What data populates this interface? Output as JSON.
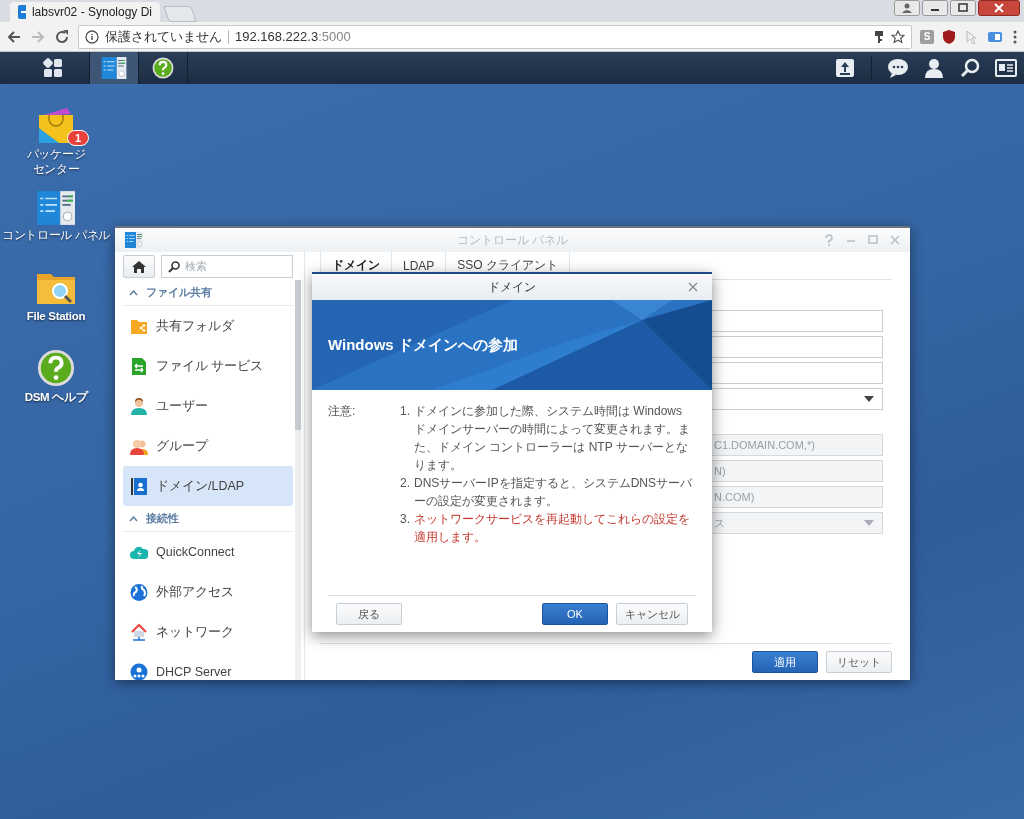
{
  "browser": {
    "tab_title": "labsvr02 - Synology Di",
    "security_label": "保護されていません",
    "url_host": "192.168.222.3",
    "url_port": ":5000",
    "extension_label": "S"
  },
  "taskbar": {
    "apps": [
      {
        "kind": "control-panel",
        "selected": true
      },
      {
        "kind": "help",
        "selected": false
      }
    ]
  },
  "desktop_icons": [
    {
      "kind": "package",
      "label_lines": [
        "パッケージ",
        "センター"
      ],
      "badge": "1"
    },
    {
      "kind": "control-panel",
      "label": "コントロール パネル"
    },
    {
      "kind": "file-station",
      "label": "File Station"
    },
    {
      "kind": "help",
      "label": "DSM ヘルプ"
    }
  ],
  "control_panel": {
    "title": "コントロール パネル",
    "search": {
      "placeholder": "検索"
    },
    "sidebar": [
      {
        "kind": "section",
        "label": "ファイル共有",
        "expanded": true
      },
      {
        "kind": "folder",
        "label": "共有フォルダ",
        "selected": false
      },
      {
        "kind": "file-service",
        "label": "ファイル サービス",
        "selected": false
      },
      {
        "kind": "user",
        "label": "ユーザー",
        "selected": false
      },
      {
        "kind": "group",
        "label": "グループ",
        "selected": false
      },
      {
        "kind": "domain",
        "label": "ドメイン/LDAP",
        "selected": true
      },
      {
        "kind": "section",
        "label": "接続性",
        "expanded": true
      },
      {
        "kind": "cloud",
        "label": "QuickConnect",
        "selected": false
      },
      {
        "kind": "globe",
        "label": "外部アクセス",
        "selected": false
      },
      {
        "kind": "network",
        "label": "ネットワーク",
        "selected": false
      },
      {
        "kind": "dhcp",
        "label": "DHCP Server",
        "selected": false
      }
    ],
    "tabs": [
      {
        "label": "ドメイン",
        "selected": true
      },
      {
        "label": "LDAP",
        "selected": false
      },
      {
        "label": "SSO クライアント",
        "selected": false
      }
    ],
    "field_groups": [
      [
        {
          "kind": "text",
          "disabled": false
        },
        {
          "kind": "text",
          "disabled": false
        },
        {
          "kind": "text",
          "disabled": false
        },
        {
          "kind": "select",
          "disabled": false
        }
      ],
      [
        {
          "kind": "text",
          "disabled": true,
          "placeholder": "C1.DOMAIN.COM,*)"
        },
        {
          "kind": "text",
          "disabled": true,
          "placeholder": "N)"
        },
        {
          "kind": "text",
          "disabled": true,
          "placeholder": "N.COM)"
        },
        {
          "kind": "select",
          "disabled": true,
          "value": "ス"
        }
      ]
    ],
    "buttons": [
      {
        "label": "適用",
        "primary": true
      },
      {
        "label": "リセット",
        "primary": false
      }
    ]
  },
  "dialog": {
    "title": "ドメイン",
    "heading": "Windows ドメインへの参加",
    "note_label": "注意:",
    "notes": [
      {
        "number": "1.",
        "text": "ドメインに参加した際、システム時間は Windows ドメインサーバーの時間によって変更されます。また、ドメイン コントローラーは NTP サーバーとなります。",
        "warning": false
      },
      {
        "number": "2.",
        "text": "DNSサーバーIPを指定すると、システムDNSサーバーの設定が変更されます。",
        "warning": false
      },
      {
        "number": "3.",
        "text": "ネットワークサービスを再起動してこれらの設定を適用します。",
        "warning": true
      }
    ],
    "back_button": "戻る",
    "buttons": [
      {
        "label": "OK",
        "primary": true
      },
      {
        "label": "キャンセル",
        "primary": false
      }
    ]
  }
}
